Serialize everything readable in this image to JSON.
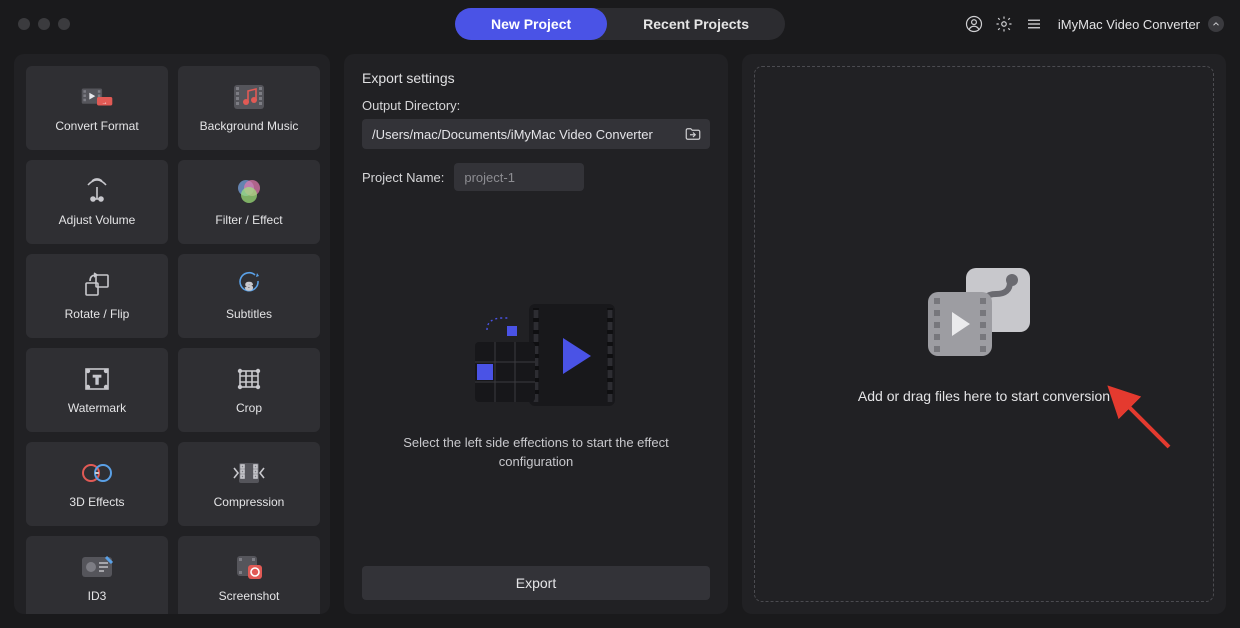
{
  "titlebar": {
    "tabs": {
      "new": "New Project",
      "recent": "Recent Projects"
    },
    "app_name": "iMyMac Video Converter"
  },
  "tools": [
    {
      "label": "Convert Format",
      "icon": "convert-format-icon"
    },
    {
      "label": "Background Music",
      "icon": "background-music-icon"
    },
    {
      "label": "Adjust Volume",
      "icon": "adjust-volume-icon"
    },
    {
      "label": "Filter / Effect",
      "icon": "filter-effect-icon"
    },
    {
      "label": "Rotate / Flip",
      "icon": "rotate-flip-icon"
    },
    {
      "label": "Subtitles",
      "icon": "subtitles-icon"
    },
    {
      "label": "Watermark",
      "icon": "watermark-icon"
    },
    {
      "label": "Crop",
      "icon": "crop-icon"
    },
    {
      "label": "3D Effects",
      "icon": "three-d-effects-icon"
    },
    {
      "label": "Compression",
      "icon": "compression-icon"
    },
    {
      "label": "ID3",
      "icon": "id3-icon"
    },
    {
      "label": "Screenshot",
      "icon": "screenshot-icon"
    }
  ],
  "settings": {
    "heading": "Export settings",
    "output_dir_label": "Output Directory:",
    "output_dir_value": "/Users/mac/Documents/iMyMac Video Converter",
    "project_name_label": "Project Name:",
    "project_name_placeholder": "project-1",
    "illustration_caption": "Select the left side effections to start the effect configuration",
    "export_label": "Export"
  },
  "dropzone": {
    "hint": "Add or drag files here to start conversion"
  }
}
